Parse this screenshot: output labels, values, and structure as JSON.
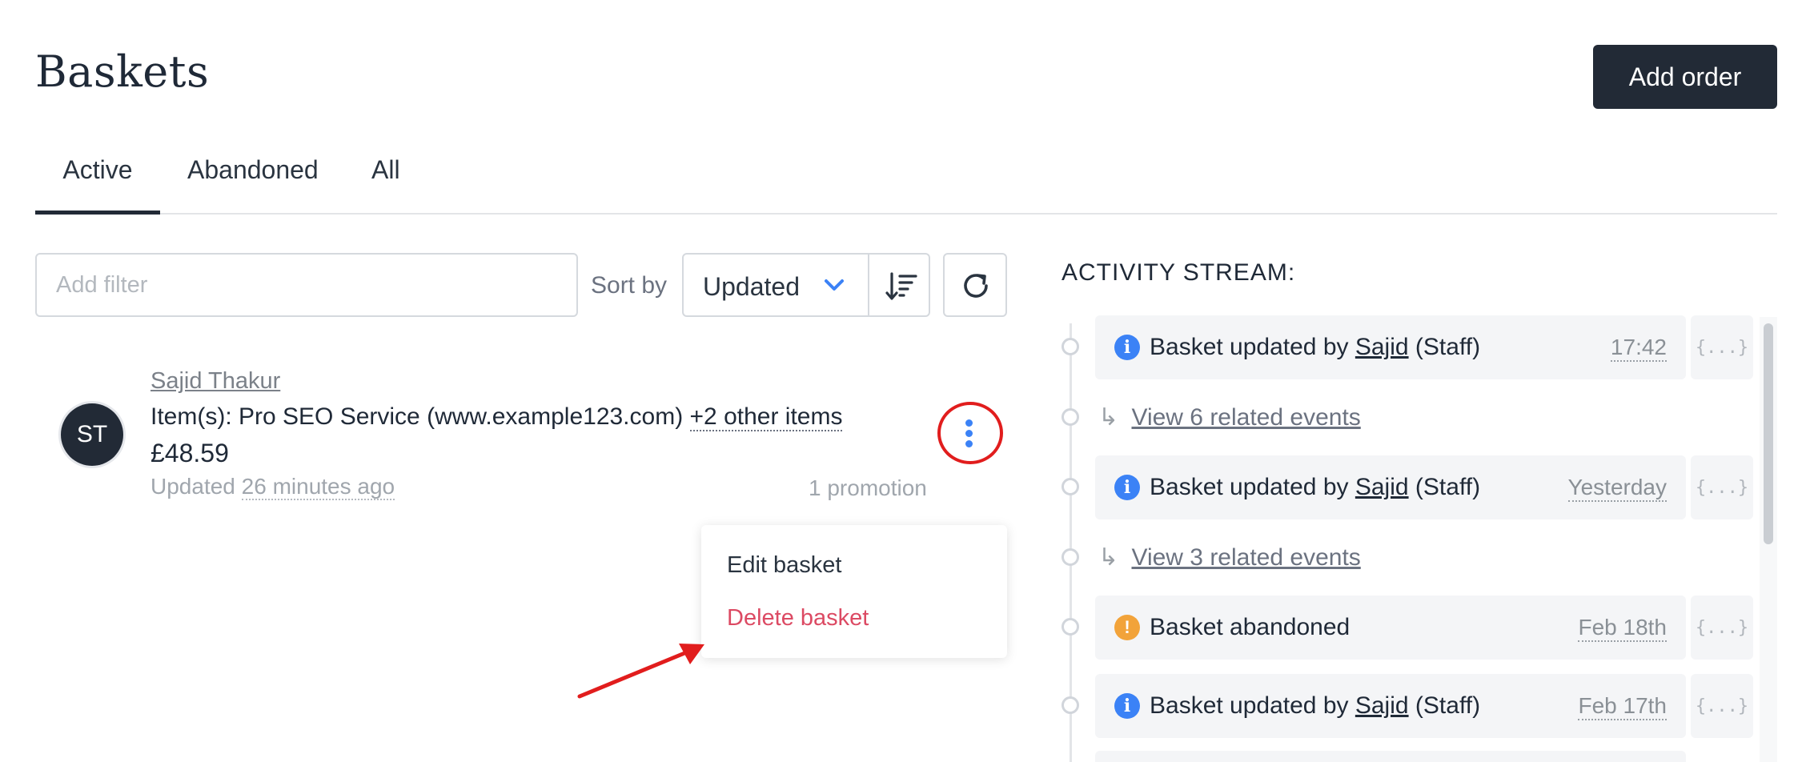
{
  "page": {
    "title": "Baskets",
    "add_order_label": "Add order"
  },
  "tabs": [
    {
      "label": "Active",
      "active": true
    },
    {
      "label": "Abandoned",
      "active": false
    },
    {
      "label": "All",
      "active": false
    }
  ],
  "filters": {
    "placeholder": "Add filter",
    "sort_label": "Sort by",
    "sort_value": "Updated"
  },
  "basket": {
    "initials": "ST",
    "customer_name": "Sajid Thakur",
    "items_prefix": "Item(s): Pro SEO Service (www.example123.com)",
    "items_more": "+2 other items",
    "price": "£48.59",
    "updated_label": "Updated",
    "updated_time": "26 minutes ago",
    "promotions": "1 promotion"
  },
  "menu": {
    "edit_label": "Edit basket",
    "delete_label": "Delete basket"
  },
  "activity": {
    "title": "ACTIVITY STREAM:",
    "json_label": "{...}",
    "related_arrow": "↳",
    "events": [
      {
        "icon": "info-icon",
        "prefix": "Basket updated by",
        "user": "Sajid",
        "suffix": "(Staff)",
        "time": "17:42"
      },
      {
        "icon": "info-icon",
        "prefix": "Basket updated by",
        "user": "Sajid",
        "suffix": "(Staff)",
        "time": "Yesterday"
      },
      {
        "icon": "warning-icon",
        "prefix": "Basket abandoned",
        "user": "",
        "suffix": "",
        "time": "Feb 18th"
      },
      {
        "icon": "info-icon",
        "prefix": "Basket updated by",
        "user": "Sajid",
        "suffix": "(Staff)",
        "time": "Feb 17th"
      }
    ],
    "related": [
      {
        "label": "View 6 related events"
      },
      {
        "label": "View 3 related events"
      }
    ]
  },
  "colors": {
    "primary_dark": "#222a36",
    "accent_blue": "#3b82f6",
    "danger": "#dc4a63",
    "warning": "#f2a33a",
    "annotation_red": "#e11d1d"
  }
}
